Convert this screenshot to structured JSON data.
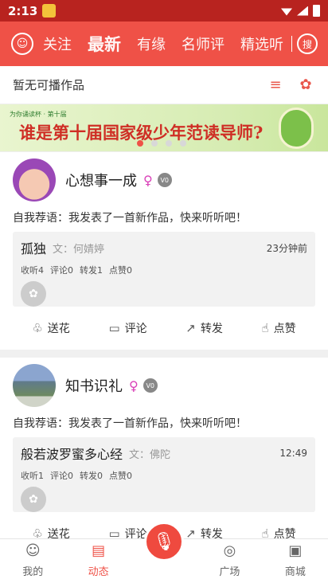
{
  "status": {
    "time": "2:13"
  },
  "nav": {
    "tabs": [
      "关注",
      "最新",
      "有缘",
      "名师评",
      "精选听"
    ],
    "search_label": "搜"
  },
  "now_playing": {
    "text": "暂无可播作品"
  },
  "banner": {
    "small": "为你诵读杯 · 第十届",
    "headline": "谁是第十届国家级少年范读导师?"
  },
  "posts": [
    {
      "name": "心想事一成",
      "gender": "♀",
      "badge": "V0",
      "recommend": "自我荐语：我发表了一首新作品，快来听听吧！",
      "work_title": "孤独",
      "work_author": "文：何婧婷",
      "work_time": "23分钟前",
      "stats": [
        "收听4",
        "评论0",
        "转发1",
        "点赞0"
      ]
    },
    {
      "name": "知书识礼",
      "gender": "♀",
      "badge": "V0",
      "recommend": "自我荐语：我发表了一首新作品，快来听听吧！",
      "work_title": "般若波罗蜜多心经",
      "work_author": "文：佛陀",
      "work_time": "12:49",
      "stats": [
        "收听1",
        "评论0",
        "转发0",
        "点赞0"
      ]
    }
  ],
  "actions": [
    "送花",
    "评论",
    "转发",
    "点赞"
  ],
  "bottom_nav": [
    "我的",
    "动态",
    "广场",
    "商城"
  ],
  "colors": {
    "brand": "#ef5147",
    "status_bar": "#b8231f"
  }
}
